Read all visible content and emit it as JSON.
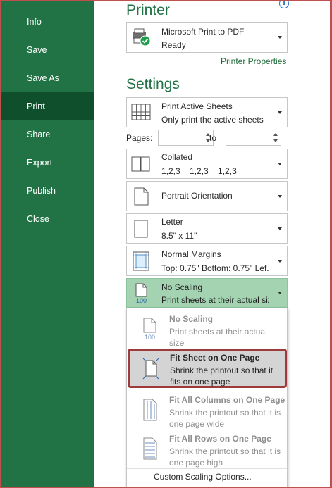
{
  "sidebar": {
    "items": [
      {
        "label": "Info"
      },
      {
        "label": "Save"
      },
      {
        "label": "Save As"
      },
      {
        "label": "Print"
      },
      {
        "label": "Share"
      },
      {
        "label": "Export"
      },
      {
        "label": "Publish"
      },
      {
        "label": "Close"
      }
    ],
    "active": "Print"
  },
  "printer": {
    "section_title": "Printer",
    "name": "Microsoft Print to PDF",
    "status": "Ready",
    "properties_link": "Printer Properties"
  },
  "settings": {
    "section_title": "Settings",
    "print_what": {
      "title": "Print Active Sheets",
      "desc": "Only print the active sheets"
    },
    "pages_label": "Pages:",
    "to_label": "to",
    "pages_from": "",
    "pages_to": "",
    "collation": {
      "title": "Collated",
      "desc": "1,2,3    1,2,3    1,2,3"
    },
    "orientation": {
      "title": "Portrait Orientation"
    },
    "paper": {
      "title": "Letter",
      "desc": "8.5\" x 11\""
    },
    "margins": {
      "title": "Normal Margins",
      "desc": "Top: 0.75\" Bottom: 0.75\" Lef..."
    },
    "scaling": {
      "title": "No Scaling",
      "desc": "Print sheets at their actual size",
      "icon_text": "100"
    }
  },
  "scaling_menu": {
    "options": [
      {
        "title": "No Scaling",
        "desc": "Print sheets at their actual size",
        "icon_text": "100"
      },
      {
        "title": "Fit Sheet on One Page",
        "desc": "Shrink the printout so that it fits on one page"
      },
      {
        "title": "Fit All Columns on One Page",
        "desc": "Shrink the printout so that it is one page wide"
      },
      {
        "title": "Fit All Rows on One Page",
        "desc": "Shrink the printout so that it is one page high"
      }
    ],
    "custom_label": "Custom Scaling Options..."
  },
  "colors": {
    "sidebar": "#217346",
    "sidebar_active": "#0f4f2c",
    "accent": "#217346",
    "selected_dropdown": "#a3d3b1",
    "highlight_border": "#9e3a3a"
  }
}
